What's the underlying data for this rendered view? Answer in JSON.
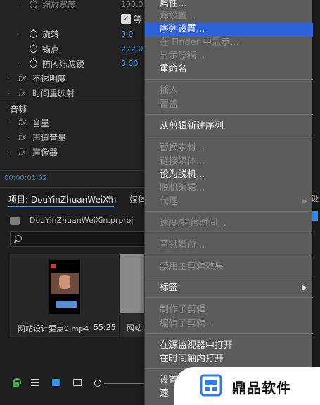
{
  "effect_controls": {
    "rows": [
      {
        "label": "缩放宽度",
        "value": "100.0",
        "disabled": true
      },
      {
        "label": "旋转",
        "value": "0.0"
      },
      {
        "label": "锚点",
        "value": "272.0"
      },
      {
        "label": "防闪烁滤镜",
        "value": "0.00"
      },
      {
        "label": "不透明度"
      },
      {
        "label": "时间重映射"
      },
      {
        "label": "音量"
      },
      {
        "label": "声道音量"
      },
      {
        "label": "声像器"
      }
    ],
    "uniform_checkbox_label": "等",
    "audio_section_label": "音频",
    "timecode": "00:00:01:02"
  },
  "project_panel": {
    "tab_label": "项目: DouYinZhuanWeiXin",
    "menu_glyph": "≡",
    "next_tab_label": "媒体",
    "file_name": "DouYinZhuanWeiXin.prproj",
    "items": [
      {
        "name": "网站设计要点0.mp4",
        "duration": "55:25"
      },
      {
        "name": "网站"
      }
    ]
  },
  "right_strip": {
    "label": "设"
  },
  "context_menu": {
    "items": [
      {
        "label": "属性...",
        "disabled": false
      },
      {
        "label": "源设置...",
        "disabled": true
      },
      {
        "label": "序列设置...",
        "disabled": false,
        "highlighted": true
      },
      {
        "label": "在 Finder 中显示...",
        "disabled": true
      },
      {
        "label": "显示原稿...",
        "disabled": true
      },
      {
        "label": "重命名",
        "disabled": false
      },
      {
        "label": "插入",
        "disabled": true
      },
      {
        "label": "覆盖",
        "disabled": true
      },
      {
        "label": "从剪辑新建序列",
        "disabled": false
      },
      {
        "label": "替换素材...",
        "disabled": true
      },
      {
        "label": "链接媒体...",
        "disabled": true
      },
      {
        "label": "设为脱机...",
        "disabled": false
      },
      {
        "label": "脱机编辑...",
        "disabled": true
      },
      {
        "label": "代理",
        "disabled": true,
        "submenu": true
      },
      {
        "label": "速度/持续时间...",
        "disabled": true
      },
      {
        "label": "音频增益...",
        "disabled": true
      },
      {
        "label": "禁用主剪辑效果",
        "disabled": true
      },
      {
        "label": "标签",
        "disabled": false,
        "submenu": true
      },
      {
        "label": "制作子剪辑",
        "disabled": true
      },
      {
        "label": "编辑子剪辑...",
        "disabled": true
      },
      {
        "label": "在源监视器中打开",
        "disabled": false
      },
      {
        "label": "在时间轴内打开",
        "disabled": false
      },
      {
        "label": "设置",
        "disabled": false
      },
      {
        "label": "速",
        "disabled": false
      }
    ],
    "submenu_glyph": "▶"
  },
  "watermark": {
    "text": "鼎品软件"
  },
  "colors": {
    "accent": "#2f63d8",
    "value_blue": "#2d8ceb",
    "menu_bg": "#5c5c5c"
  }
}
